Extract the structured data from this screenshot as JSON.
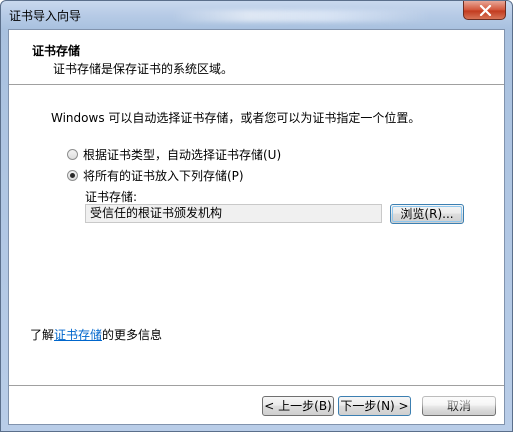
{
  "window": {
    "title": "证书导入向导"
  },
  "header": {
    "title": "证书存储",
    "subtitle": "证书存储是保存证书的系统区域。"
  },
  "body": {
    "intro": "Windows 可以自动选择证书存储，或者您可以为证书指定一个位置。",
    "options": [
      {
        "label": "根据证书类型，自动选择证书存储(U)",
        "checked": false
      },
      {
        "label": "将所有的证书放入下列存储(P)",
        "checked": true
      }
    ],
    "store_label": "证书存储:",
    "store_value": "受信任的根证书颁发机构",
    "browse_label": "浏览(R)..."
  },
  "footer_link": {
    "prefix": "了解",
    "link_text": "证书存储",
    "suffix": "的更多信息"
  },
  "buttons": {
    "back": "< 上一步(B)",
    "next": "下一步(N) >",
    "cancel": "取消"
  },
  "colors": {
    "link": "#0066cc",
    "close_button": "#c23b1f"
  },
  "icons": {
    "close": "close-icon"
  }
}
